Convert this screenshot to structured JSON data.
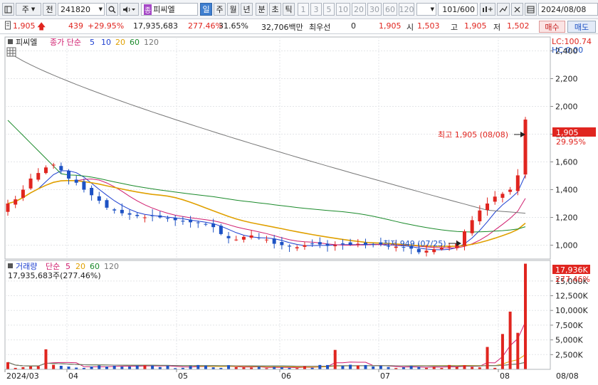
{
  "toolbar": {
    "chart_icon": "chart-window-icon",
    "period_select": "주",
    "prev_label": "전",
    "code": "241820",
    "stock_name": "피씨엘",
    "stock_badge": "종",
    "periods": [
      "일",
      "주",
      "월",
      "년",
      "분",
      "초",
      "틱"
    ],
    "active_period": "일",
    "numbers": [
      "1",
      "3",
      "5",
      "10",
      "20",
      "30",
      "60",
      "120"
    ],
    "count": "101",
    "count_total": "/600",
    "date": "2024/08/08"
  },
  "quote": {
    "price": "1,905",
    "change": "439",
    "change_pct": "+29.95%",
    "volume": "17,935,683",
    "volume_pct": "277.46%",
    "turnover": "31.65%",
    "amount": "32,706백만",
    "priority_label": "최우선",
    "priority_value": "0",
    "priority_price": "1,905",
    "open_label": "시",
    "open": "1,503",
    "high_label": "고",
    "high": "1,905",
    "low_label": "저",
    "low": "1,502",
    "buy_label": "매수",
    "sell_label": "매도"
  },
  "price_panel": {
    "legend_name": "피씨엘",
    "legend_ma": "종가 단순",
    "ma_periods": [
      "5",
      "10",
      "20",
      "60",
      "120"
    ],
    "ma_colors": [
      "#1d3fd0",
      "#d01d6e",
      "#e0a000",
      "#1a8a2a",
      "#777777"
    ],
    "lc": "LC:100.74",
    "hc": "HC:0.00",
    "y_ticks": [
      "2,400",
      "2,200",
      "2,000",
      "1,800",
      "1,600",
      "1,400",
      "1,200",
      "1,000"
    ],
    "last_price": "1,905",
    "last_pct": "29.95%",
    "high_annotation": "최고 1,905 (08/08)",
    "low_annotation": "최저 949 (07/25)"
  },
  "volume_panel": {
    "legend_name": "거래량",
    "legend_ma": "단순",
    "ma_periods": [
      "5",
      "20",
      "60",
      "120"
    ],
    "volume_info": "17,935,683주(277.46%)",
    "last_volume": "17,936K",
    "last_pct": "277.46%",
    "y_ticks": [
      "15,000K",
      "12,500K",
      "10,000K",
      "7,500K",
      "5,000K",
      "2,500K"
    ]
  },
  "x_labels": [
    "2024/03",
    "04",
    "05",
    "06",
    "07",
    "08",
    "08/08"
  ],
  "chart_data": {
    "type": "candlestick",
    "title": "",
    "x": [
      "2024/03",
      "04",
      "05",
      "06",
      "07",
      "08"
    ],
    "ylim": [
      900,
      2500
    ],
    "close_series_approx": [
      1300,
      1330,
      1400,
      1480,
      1520,
      1560,
      1580,
      1540,
      1480,
      1450,
      1400,
      1360,
      1320,
      1270,
      1250,
      1230,
      1220,
      1210,
      1200,
      1210,
      1200,
      1190,
      1180,
      1170,
      1165,
      1160,
      1150,
      1130,
      1080,
      1050,
      1040,
      1060,
      1070,
      1050,
      1040,
      1010,
      1000,
      990,
      985,
      1000,
      1010,
      1005,
      995,
      1000,
      1010,
      1005,
      1010,
      1000,
      1005,
      1005,
      995,
      990,
      985,
      975,
      949,
      960,
      970,
      980,
      990,
      1010,
      1100,
      1180,
      1250,
      1300,
      1350,
      1370,
      1400,
      1503,
      1905
    ],
    "volume_ylim_k": [
      0,
      18000
    ],
    "last_volume_k": 17936
  }
}
